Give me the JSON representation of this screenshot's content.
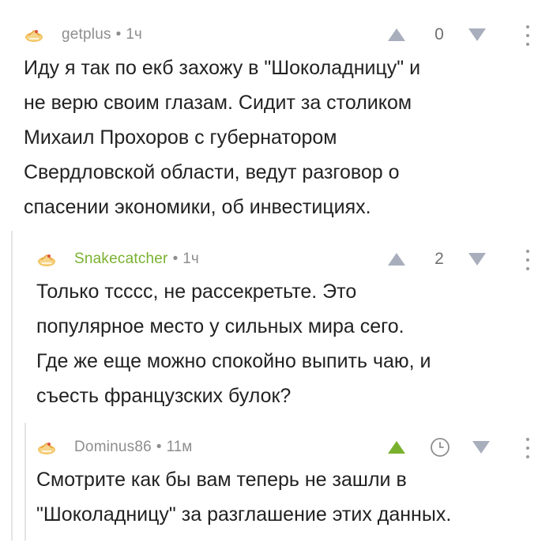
{
  "comments": [
    {
      "author": "getplus",
      "separator": "•",
      "time": "1ч",
      "rating": "0",
      "text": "Иду я так по екб захожу в \"Шоколадницу\" и\nне верю своим глазам. Сидит за столиком\nМихаил Прохоров с губернатором\nСвердловской области, ведут разговор о\nспасении экономики, об инвестициях."
    },
    {
      "author": "Snakecatcher",
      "separator": "•",
      "time": "1ч",
      "rating": "2",
      "text": "Только тсссс, не рассекретьте. Это\nпопулярное место у сильных мира сего.\nГде же еще можно спокойно выпить чаю, и\nсъесть французских булок?"
    },
    {
      "author": "Dominus86",
      "separator": "•",
      "time": "11м",
      "text": "Смотрите как бы вам теперь не зашли в\n\"Шоколадницу\" за разглашение этих данных."
    }
  ],
  "icons": {
    "avatar": "cake-avatar-icon",
    "upvote": "arrow-up-icon",
    "downvote": "arrow-down-icon",
    "more": "more-vertical-icon",
    "pending": "clock-icon"
  },
  "colors": {
    "author_default": "#8e8e8e",
    "author_highlight": "#79b12f",
    "upvote_active": "#79b12f",
    "vote_inactive": "#a8aebc",
    "text": "#222222"
  }
}
